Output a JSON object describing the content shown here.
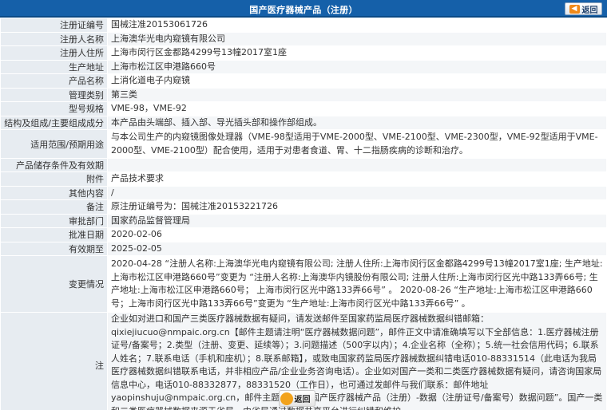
{
  "header": {
    "title": "国产医疗器械产品（注册）",
    "back_label": "返回"
  },
  "rows": [
    {
      "label": "注册证编号",
      "value": "国械注准20153061726"
    },
    {
      "label": "注册人名称",
      "value": "上海澳华光电内窥镜有限公司"
    },
    {
      "label": "注册人住所",
      "value": "上海市闵行区金都路4299号13幢2017室1座"
    },
    {
      "label": "生产地址",
      "value": "上海市松江区申港路660号"
    },
    {
      "label": "产品名称",
      "value": "上消化道电子内窥镜"
    },
    {
      "label": "管理类别",
      "value": "第三类"
    },
    {
      "label": "型号规格",
      "value": "VME-98，VME-92"
    },
    {
      "label": "结构及组成/主要组成成分",
      "value": "本产品由头端部、插入部、导光插头部和操作部组成。"
    },
    {
      "label": "适用范围/预期用途",
      "value": "与本公司生产的内窥镜图像处理器（VME-98型适用于VME-2000型、VME-2100型、VME-2300型，VME-92型适用于VME-2000型、VME-2100型）配合使用，适用于对患者食道、胃、十二指肠疾病的诊断和治疗。"
    },
    {
      "label": "产品储存条件及有效期",
      "value": ""
    },
    {
      "label": "附件",
      "value": "产品技术要求"
    },
    {
      "label": "其他内容",
      "value": "/"
    },
    {
      "label": "备注",
      "value": "原注册证编号为：国械注准20153221726"
    },
    {
      "label": "审批部门",
      "value": "国家药品监督管理局"
    },
    {
      "label": "批准日期",
      "value": "2020-02-06"
    },
    {
      "label": "有效期至",
      "value": "2025-02-05"
    },
    {
      "label": "变更情况",
      "value": "2020-04-28 “注册人名称:上海澳华光电内窥镜有限公司; 注册人住所:上海市闵行区金都路4299号13幢2017室1座; 生产地址:上海市松江区申港路660号”变更为 “注册人名称:上海澳华内镜股份有限公司; 注册人住所:上海市闵行区光中路133弄66号; 生产地址:上海市松江区申港路660号； 上海市闵行区光中路133弄66号” 。 2020-08-26 “生产地址:上海市松江区申港路660号；上海市闵行区光中路133弄66号”变更为 “生产地址:上海市闵行区光中路133弄66号” 。"
    },
    {
      "label": "注",
      "value": "企业如对进口和国产三类医疗器械数据有疑问，请发送邮件至国家药监局医疗器械数据纠错邮箱：qixiejiucuo@nmpaic.org.cn【邮件主题请注明“医疗器械数据问题”，邮件正文中请准确填写以下全部信息：1.医疗器械注册证号/备案号；2.类型（注册、变更、延续等）；3.问题描述（500字以内）；4.企业名称（全称）；5.统一社会信用代码；6.联系人姓名；7.联系电话（手机和座机）；8.联系邮箱】，或致电国家药监局医疗器械数据纠错电话010-88331514（此电话为我局医疗器械数据纠错联系电话，并非相应产品/企业业务咨询电话）。企业如对国产一类和二类医疗器械数据有疑问，请咨询国家局信息中心，电话010-88332877，88331520（工作日），也可通过发邮件与我们联系：邮件地址yaopinshuju@nmpaic.org.cn，邮件主题请注明“国产医疗器械产品（注册）-数据（注册证号/备案号）数据问题”。国产一类和二类医疗器械数据来源于省局，由省局通过数据共享平台进行纠错和维护。"
    }
  ],
  "footer": {
    "back_label": "返回"
  }
}
